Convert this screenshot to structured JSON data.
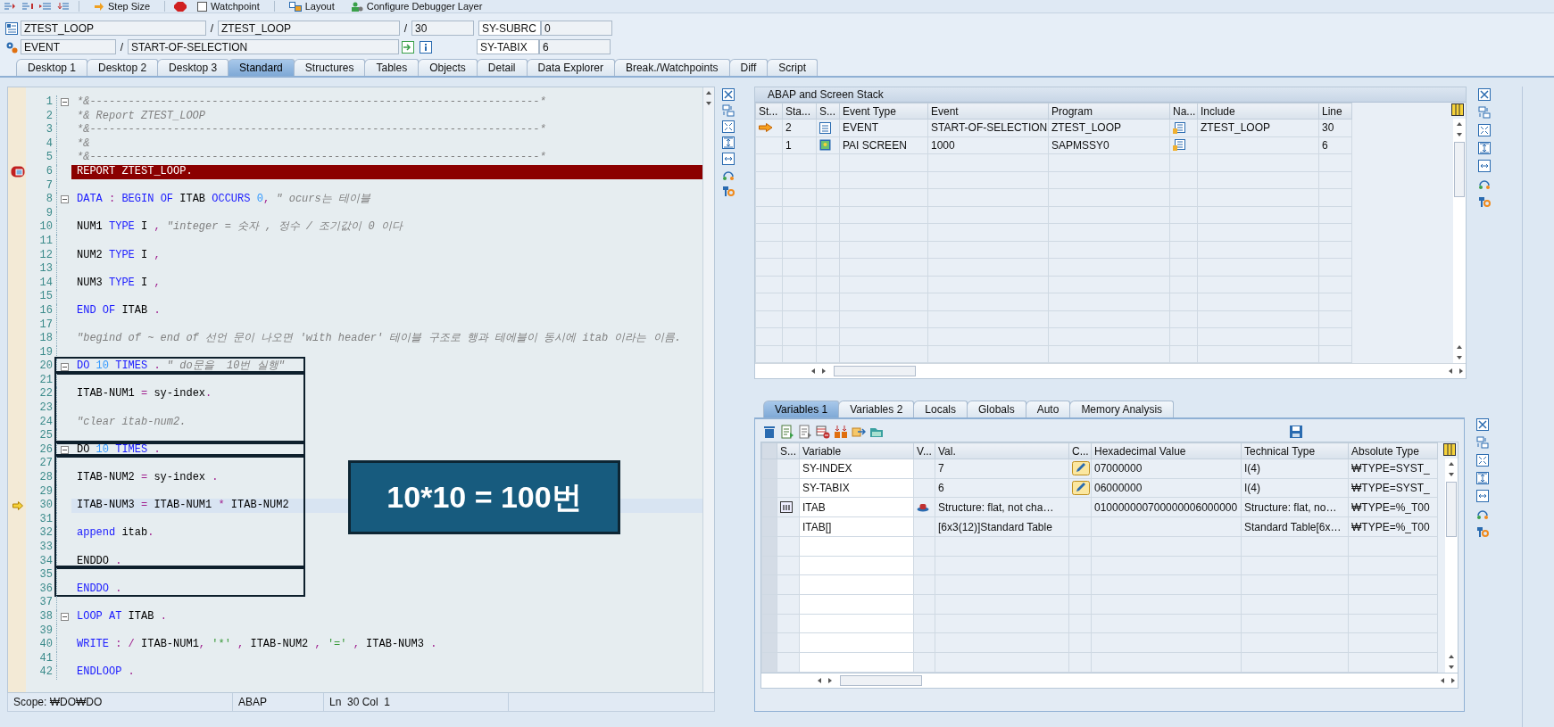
{
  "toolbar": [
    {
      "label": "Step Size"
    },
    {
      "label": "Watchpoint"
    },
    {
      "label": "Layout"
    },
    {
      "label": "Configure Debugger Layer"
    }
  ],
  "header": {
    "program": "ZTEST_LOOP",
    "include": "ZTEST_LOOP",
    "line": "30",
    "event_kind": "EVENT",
    "event": "START-OF-SELECTION",
    "separators": [
      "/",
      "/",
      "/"
    ],
    "system_fields": [
      {
        "name": "SY-SUBRC",
        "value": "0"
      },
      {
        "name": "SY-TABIX",
        "value": "6"
      }
    ]
  },
  "tabs": [
    {
      "label": "Desktop 1",
      "selected": false
    },
    {
      "label": "Desktop 2",
      "selected": false
    },
    {
      "label": "Desktop 3",
      "selected": false
    },
    {
      "label": "Standard",
      "selected": true
    },
    {
      "label": "Structures",
      "selected": false
    },
    {
      "label": "Tables",
      "selected": false
    },
    {
      "label": "Objects",
      "selected": false
    },
    {
      "label": "Detail",
      "selected": false
    },
    {
      "label": "Data Explorer",
      "selected": false
    },
    {
      "label": "Break./Watchpoints",
      "selected": false
    },
    {
      "label": "Diff",
      "selected": false
    },
    {
      "label": "Script",
      "selected": false
    }
  ],
  "code": {
    "blocks": [
      {
        "framed": false,
        "lines": [
          {
            "number": "1",
            "kind": "plain",
            "fold": true,
            "tokens": [
              {
                "kind": "comment",
                "text": "*&----------------------------------------------------------------------*"
              }
            ]
          },
          {
            "number": "2",
            "kind": "plain",
            "tokens": [
              {
                "kind": "comment",
                "text": "*& Report ZTEST_LOOP"
              }
            ]
          },
          {
            "number": "3",
            "kind": "plain",
            "tokens": [
              {
                "kind": "comment",
                "text": "*&----------------------------------------------------------------------*"
              }
            ]
          },
          {
            "number": "4",
            "kind": "plain",
            "tokens": [
              {
                "kind": "comment",
                "text": "*&"
              }
            ]
          },
          {
            "number": "5",
            "kind": "plain",
            "tokens": [
              {
                "kind": "comment",
                "text": "*&----------------------------------------------------------------------*"
              }
            ]
          },
          {
            "number": "6",
            "kind": "breakpoint",
            "tokens": [
              {
                "kind": "identifier",
                "text": "REPORT ZTEST_LOOP."
              }
            ]
          },
          {
            "number": "7",
            "kind": "plain"
          },
          {
            "number": "8",
            "kind": "plain",
            "fold": true,
            "tokens": [
              {
                "kind": "keyword",
                "text": "DATA"
              },
              {
                "kind": "operator",
                "text": " : "
              },
              {
                "kind": "keyword",
                "text": "BEGIN OF "
              },
              {
                "kind": "identifier",
                "text": "ITAB "
              },
              {
                "kind": "keyword",
                "text": "OCCURS "
              },
              {
                "kind": "number",
                "text": "0"
              },
              {
                "kind": "operator",
                "text": ", "
              },
              {
                "kind": "comment",
                "text": "\" ocurs는 테이블"
              }
            ]
          },
          {
            "number": "9",
            "kind": "plain"
          },
          {
            "number": "10",
            "kind": "plain",
            "tokens": [
              {
                "kind": "identifier",
                "text": "NUM1 "
              },
              {
                "kind": "keyword",
                "text": "TYPE "
              },
              {
                "kind": "identifier",
                "text": "I "
              },
              {
                "kind": "operator",
                "text": ", "
              },
              {
                "kind": "comment",
                "text": "\"integer = 숫자 , 정수 / 조기값이 0 이다"
              }
            ]
          },
          {
            "number": "11",
            "kind": "plain"
          },
          {
            "number": "12",
            "kind": "plain",
            "tokens": [
              {
                "kind": "identifier",
                "text": "NUM2 "
              },
              {
                "kind": "keyword",
                "text": "TYPE "
              },
              {
                "kind": "identifier",
                "text": "I "
              },
              {
                "kind": "operator",
                "text": ","
              }
            ]
          },
          {
            "number": "13",
            "kind": "plain"
          },
          {
            "number": "14",
            "kind": "plain",
            "tokens": [
              {
                "kind": "identifier",
                "text": "NUM3 "
              },
              {
                "kind": "keyword",
                "text": "TYPE "
              },
              {
                "kind": "identifier",
                "text": "I "
              },
              {
                "kind": "operator",
                "text": ","
              }
            ]
          },
          {
            "number": "15",
            "kind": "plain"
          },
          {
            "number": "16",
            "kind": "plain",
            "tokens": [
              {
                "kind": "keyword",
                "text": "END OF "
              },
              {
                "kind": "identifier",
                "text": "ITAB "
              },
              {
                "kind": "operator",
                "text": "."
              }
            ]
          },
          {
            "number": "17",
            "kind": "plain"
          },
          {
            "number": "18",
            "kind": "plain",
            "tokens": [
              {
                "kind": "comment",
                "text": "\"begind of ~ end of 선언 문이 나오면 'with header' 테이블 구조로 행과 테에블이 동시에 itab 이라는 이름."
              }
            ]
          },
          {
            "number": "19",
            "kind": "plain"
          }
        ]
      },
      {
        "framed": true,
        "lines": [
          {
            "number": "20",
            "kind": "plain",
            "fold": true,
            "tokens": [
              {
                "kind": "keyword",
                "text": "DO "
              },
              {
                "kind": "number",
                "text": "10 "
              },
              {
                "kind": "keyword",
                "text": "TIMES "
              },
              {
                "kind": "operator",
                "text": ". "
              },
              {
                "kind": "comment",
                "text": "\" do문을  10번 실행\""
              }
            ]
          }
        ]
      },
      {
        "framed": true,
        "lines": [
          {
            "number": "21",
            "kind": "plain"
          },
          {
            "number": "22",
            "kind": "plain",
            "tokens": [
              {
                "kind": "identifier",
                "text": "ITAB-NUM1 "
              },
              {
                "kind": "operator",
                "text": "= "
              },
              {
                "kind": "identifier",
                "text": "sy-index"
              },
              {
                "kind": "operator",
                "text": "."
              }
            ]
          },
          {
            "number": "23",
            "kind": "plain"
          },
          {
            "number": "24",
            "kind": "plain",
            "tokens": [
              {
                "kind": "comment",
                "text": "\"clear itab-num2."
              }
            ]
          },
          {
            "number": "25",
            "kind": "plain"
          }
        ]
      },
      {
        "framed": true,
        "lines": [
          {
            "number": "26",
            "kind": "plain",
            "fold": true,
            "tokens": [
              {
                "kind": "identifier",
                "text": "DO "
              },
              {
                "kind": "number",
                "text": "10 "
              },
              {
                "kind": "keyword",
                "text": "TIMES "
              },
              {
                "kind": "operator",
                "text": "."
              }
            ]
          }
        ]
      },
      {
        "framed": true,
        "lines": [
          {
            "number": "27",
            "kind": "plain"
          },
          {
            "number": "28",
            "kind": "plain",
            "tokens": [
              {
                "kind": "identifier",
                "text": "ITAB-NUM2 "
              },
              {
                "kind": "operator",
                "text": "= "
              },
              {
                "kind": "identifier",
                "text": "sy-index "
              },
              {
                "kind": "operator",
                "text": "."
              }
            ]
          },
          {
            "number": "29",
            "kind": "plain"
          },
          {
            "number": "30",
            "kind": "current",
            "tokens": [
              {
                "kind": "identifier",
                "text": "ITAB-NUM3 "
              },
              {
                "kind": "operator",
                "text": "= "
              },
              {
                "kind": "identifier",
                "text": "ITAB-NUM1 "
              },
              {
                "kind": "operator",
                "text": "* "
              },
              {
                "kind": "identifier",
                "text": "ITAB-NUM2"
              }
            ]
          },
          {
            "number": "31",
            "kind": "plain"
          },
          {
            "number": "32",
            "kind": "plain",
            "tokens": [
              {
                "kind": "keyword",
                "text": "append "
              },
              {
                "kind": "identifier",
                "text": "itab"
              },
              {
                "kind": "operator",
                "text": "."
              }
            ]
          },
          {
            "number": "33",
            "kind": "plain"
          },
          {
            "number": "34",
            "kind": "plain",
            "tokens": [
              {
                "kind": "identifier",
                "text": "ENDDO "
              },
              {
                "kind": "operator",
                "text": "."
              }
            ]
          }
        ]
      },
      {
        "framed": true,
        "lines": [
          {
            "number": "35",
            "kind": "plain"
          },
          {
            "number": "36",
            "kind": "plain",
            "tokens": [
              {
                "kind": "keyword",
                "text": "ENDDO "
              },
              {
                "kind": "operator",
                "text": "."
              }
            ]
          }
        ]
      },
      {
        "framed": false,
        "lines": [
          {
            "number": "37",
            "kind": "plain"
          },
          {
            "number": "38",
            "kind": "plain",
            "fold": true,
            "tokens": [
              {
                "kind": "keyword",
                "text": "LOOP AT "
              },
              {
                "kind": "identifier",
                "text": "ITAB "
              },
              {
                "kind": "operator",
                "text": "."
              }
            ]
          },
          {
            "number": "39",
            "kind": "plain"
          },
          {
            "number": "40",
            "kind": "plain",
            "tokens": [
              {
                "kind": "keyword",
                "text": "WRITE "
              },
              {
                "kind": "operator",
                "text": ": / "
              },
              {
                "kind": "identifier",
                "text": "ITAB-NUM1"
              },
              {
                "kind": "operator",
                "text": ", "
              },
              {
                "kind": "string",
                "text": "'*'"
              },
              {
                "kind": "operator",
                "text": " , "
              },
              {
                "kind": "identifier",
                "text": "ITAB-NUM2 "
              },
              {
                "kind": "operator",
                "text": ", "
              },
              {
                "kind": "string",
                "text": "'='"
              },
              {
                "kind": "operator",
                "text": " , "
              },
              {
                "kind": "identifier",
                "text": "ITAB-NUM3 "
              },
              {
                "kind": "operator",
                "text": "."
              }
            ]
          },
          {
            "number": "41",
            "kind": "plain"
          },
          {
            "number": "42",
            "kind": "plain",
            "tokens": [
              {
                "kind": "keyword",
                "text": "ENDLOOP "
              },
              {
                "kind": "operator",
                "text": "."
              }
            ]
          }
        ]
      }
    ],
    "callout": "10*10 = 100번"
  },
  "status_bar": {
    "scope": "Scope: ₩DO₩DO",
    "language": "ABAP",
    "position": "Ln  30 Col  1"
  },
  "stack": {
    "title": "ABAP and Screen Stack",
    "columns": [
      "St...",
      "Sta...",
      "S...",
      "Event Type",
      "Event",
      "Program",
      "Na...",
      "Include",
      "Line"
    ],
    "rows": [
      {
        "kind": "event",
        "current": true,
        "stack": "2",
        "event_type": "EVENT",
        "event": "START-OF-SELECTION",
        "program": "ZTEST_LOOP",
        "include": "ZTEST_LOOP",
        "line": "30"
      },
      {
        "kind": "screen",
        "current": false,
        "stack": "1",
        "event_type": "PAI SCREEN",
        "event": "1000",
        "program": "SAPMSSY0",
        "line": "6"
      }
    ]
  },
  "variables": {
    "tabs": [
      {
        "label": "Variables 1",
        "selected": true
      },
      {
        "label": "Variables 2",
        "selected": false
      },
      {
        "label": "Locals",
        "selected": false
      },
      {
        "label": "Globals",
        "selected": false
      },
      {
        "label": "Auto",
        "selected": false
      },
      {
        "label": "Memory Analysis",
        "selected": false
      }
    ],
    "columns": [
      "S...",
      "Variable",
      "V...",
      "Val.",
      "C...",
      "Hexadecimal Value",
      "Technical Type",
      "Absolute Type"
    ],
    "rows": [
      {
        "kind": "field",
        "variable": "SY-INDEX",
        "value": "7",
        "editable": true,
        "hex": "07000000",
        "technical_type": "I(4)",
        "absolute_type": "₩TYPE=SYST_"
      },
      {
        "kind": "field",
        "variable": "SY-TABIX",
        "value": "6",
        "editable": true,
        "hex": "06000000",
        "technical_type": "I(4)",
        "absolute_type": "₩TYPE=SYST_"
      },
      {
        "kind": "structure",
        "variable": "ITAB",
        "value": "Structure: flat, not cha…",
        "editable": false,
        "hex": "010000000700000006000000",
        "technical_type": "Structure: flat, no…",
        "absolute_type": "₩TYPE=%_T00"
      },
      {
        "kind": "table",
        "variable": "ITAB[]",
        "value": "[6x3(12)]Standard Table",
        "editable": false,
        "technical_type": "Standard Table[6x…",
        "absolute_type": "₩TYPE=%_T00"
      }
    ]
  }
}
